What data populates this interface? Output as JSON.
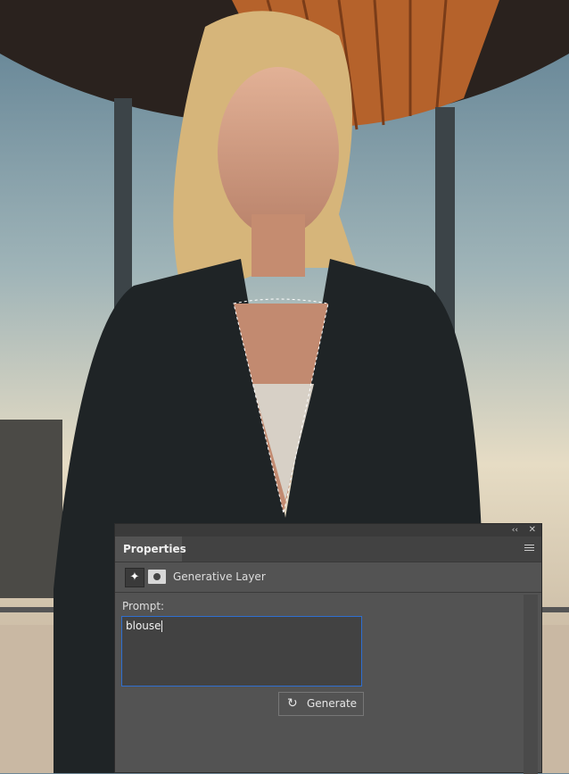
{
  "panel": {
    "tab_label": "Properties",
    "collapse_icon": "double-chevron-left-icon",
    "close_icon": "close-icon",
    "layer_type": "Generative Layer",
    "prompt_label": "Prompt:",
    "prompt_value": "blouse",
    "generate_label": "Generate",
    "accent_color": "#2f6fd0"
  }
}
